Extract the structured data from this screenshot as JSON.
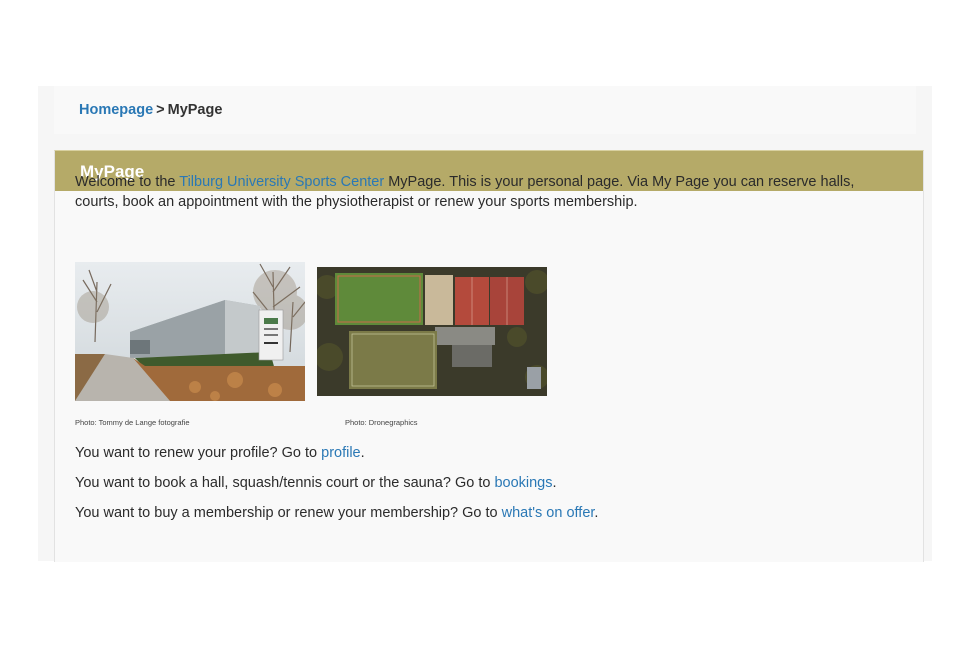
{
  "breadcrumb": {
    "home": "Homepage",
    "separator": ">",
    "current": "MyPage"
  },
  "panel": {
    "title": "MyPage",
    "header_color": "#b5aa68"
  },
  "intro": {
    "before": "Welcome to the ",
    "link": "Tilburg University Sports Center",
    "after": " MyPage. This is your personal page. Via My Page you can reserve halls, courts, book an appointment with the physiotherapist or renew your sports membership."
  },
  "photos": [
    {
      "subject": "sports-center-building",
      "caption": "Photo: Tommy de Lange fotografie"
    },
    {
      "subject": "aerial-sports-fields",
      "caption": "Photo: Dronegraphics"
    }
  ],
  "lines": [
    {
      "before": "You want to renew your profile? Go to ",
      "link": "profile",
      "after": "."
    },
    {
      "before": "You want to book a hall, squash/tennis court or the sauna? Go to ",
      "link": "bookings",
      "after": "."
    },
    {
      "before": "You want to buy a membership or renew your membership? Go to ",
      "link": "what's on offer",
      "after": "."
    }
  ],
  "colors": {
    "link": "#2a78b5",
    "accent": "#b5aa68"
  }
}
